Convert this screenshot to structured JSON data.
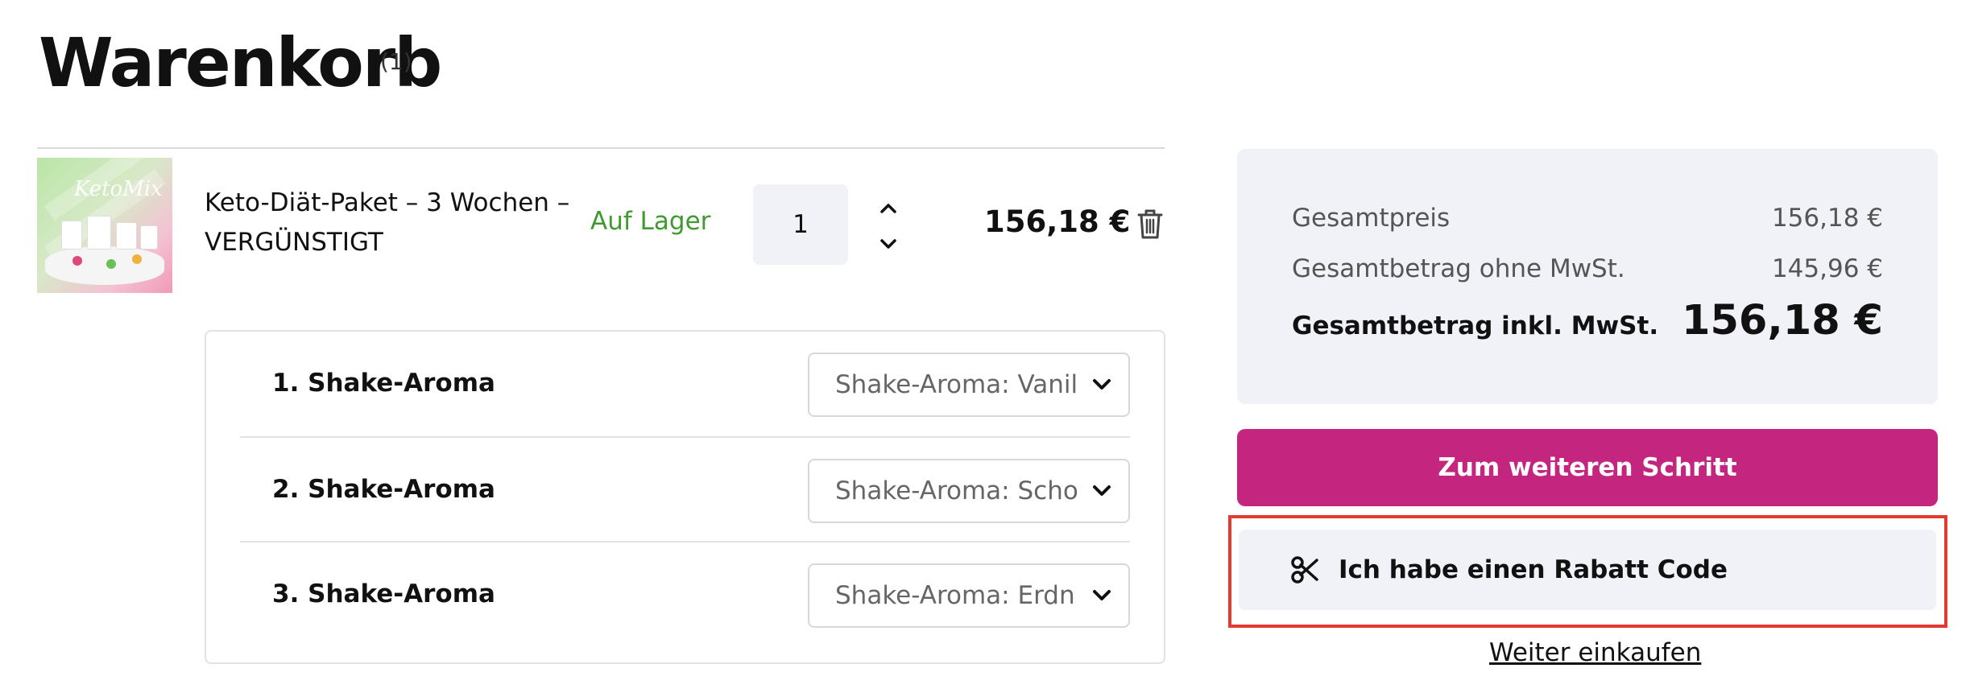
{
  "page": {
    "title": "Warenkorb",
    "count": "(1)"
  },
  "cart_item": {
    "name": "Keto-Diät-Paket – 3 Wochen – VERGÜNSTIGT",
    "stock": "Auf Lager",
    "quantity": "1",
    "price": "156,18 €",
    "image_brand": "KetoMix",
    "icons": {
      "increase": "chevron-up-icon",
      "decrease": "chevron-down-icon",
      "delete": "trash-icon"
    }
  },
  "options": [
    {
      "label": "1. Shake-Aroma",
      "value": "Shake-Aroma: Vanille"
    },
    {
      "label": "2. Shake-Aroma",
      "value": "Shake-Aroma: Schoko"
    },
    {
      "label": "3. Shake-Aroma",
      "value": "Shake-Aroma: Erdnuss"
    }
  ],
  "summary": {
    "total_label": "Gesamtpreis",
    "total_value": "156,18 €",
    "net_label": "Gesamtbetrag ohne MwSt.",
    "net_value": "145,96 €",
    "gross_label": "Gesamtbetrag inkl. MwSt.",
    "gross_value": "156,18 €"
  },
  "actions": {
    "next_step": "Zum weiteren Schritt",
    "coupon": "Ich habe einen Rabatt Code",
    "continue_shopping": "Weiter einkaufen"
  },
  "colors": {
    "accent": "#c4257f",
    "in_stock": "#3f9a2f",
    "panel_bg": "#f1f2f7",
    "highlight": "#e53a2f"
  }
}
